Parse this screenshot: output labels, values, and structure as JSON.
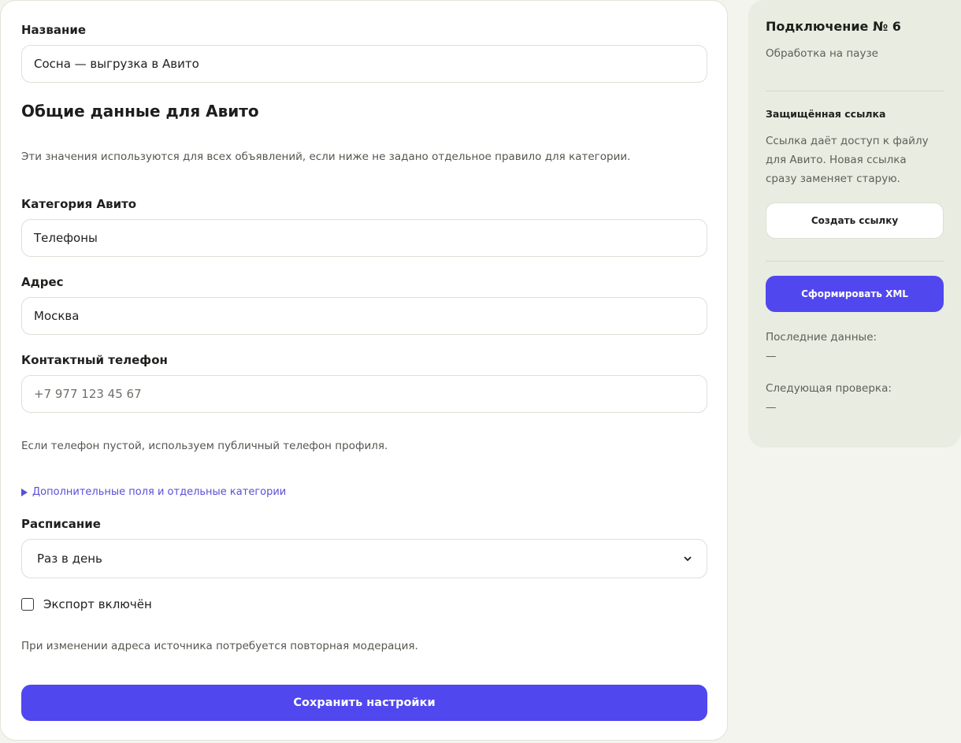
{
  "form": {
    "name_label": "Название",
    "name_value": "Сосна — выгрузка в Авито",
    "section_title": "Общие данные для Авито",
    "section_hint": "Эти значения используются для всех объявлений, если ниже не задано отдельное правило для категории.",
    "category_label": "Категория Авито",
    "category_value": "Телефоны",
    "address_label": "Адрес",
    "address_value": "Москва",
    "phone_label": "Контактный телефон",
    "phone_placeholder": "+7 977 123 45 67",
    "phone_hint": "Если телефон пустой, используем публичный телефон профиля.",
    "extra_fields_link": "Дополнительные поля и отдельные категории",
    "schedule_label": "Расписание",
    "schedule_value": "Раз в день",
    "export_label": "Экспорт включён",
    "export_checked": false,
    "moderation_hint": "При изменении адреса источника потребуется повторная модерация.",
    "save_label": "Сохранить настройки"
  },
  "sidebar": {
    "title": "Подключение № 6",
    "status": "Обработка на паузе",
    "secure_link_title": "Защищённая ссылка",
    "secure_link_desc": "Ссылка даёт доступ к файлу для Авито. Новая ссылка сразу заменяет старую.",
    "create_link_label": "Создать ссылку",
    "generate_xml_label": "Сформировать XML",
    "last_data_label": "Последние данные:",
    "last_data_value": "—",
    "next_check_label": "Следующая проверка:",
    "next_check_value": "—"
  },
  "colors": {
    "accent": "#5147ef",
    "link": "#5a4fd6",
    "sidebar_bg": "#e9ece0"
  },
  "icons": {
    "disclosure": "triangle-right-icon",
    "select_arrow": "chevron-down-icon"
  }
}
